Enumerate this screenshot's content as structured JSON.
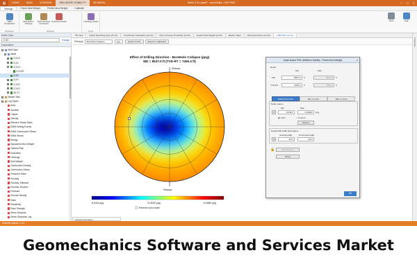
{
  "window": {
    "title": "Wells 2-XX.psset* - sceneData - LMP PMV",
    "menu": [
      "HOME",
      "DATA",
      "1D MODEL",
      "WELLBORE STABILITY",
      "3D MODEL"
    ],
    "active_menu": 3
  },
  "ribbon": {
    "tabs": [
      "Settings",
      "Check Mud Weight",
      "Predict Mud Weight",
      "Calibrate"
    ],
    "buttons": [
      "WBS Preparation",
      "Well Datum Settings",
      "Rock Settings Constants",
      "Advanced Mode",
      "Lithology Model",
      "Tools",
      "Help"
    ],
    "groups": [
      "Workflow",
      "Settings",
      "Tools"
    ]
  },
  "left_panel": {
    "header": "Active Case",
    "well_selector": "Z-XX",
    "change_link": "Change",
    "subheader": "Explorations",
    "tree": [
      {
        "label": "Well Data",
        "indent": 0,
        "box": "-",
        "color": "#6b8fc7"
      },
      {
        "label": "Wells",
        "indent": 1,
        "box": "-",
        "color": "#6b8fc7"
      },
      {
        "label": "Z-XX2",
        "indent": 2,
        "box": "+",
        "color": "#3c8d3c"
      },
      {
        "label": "Z-XX",
        "indent": 2,
        "box": "+",
        "color": "#3c8d3c"
      },
      {
        "label": "Z-XX3",
        "indent": 2,
        "box": "-",
        "color": "#3c8d3c"
      },
      {
        "label": "Z-XXST",
        "indent": 3,
        "box": "",
        "color": "#3c8d3c"
      },
      {
        "label": "Z-XX",
        "indent": 2,
        "box": "",
        "color": "#3c8d3c",
        "selected": true
      },
      {
        "label": "Z-XX",
        "indent": 2,
        "box": "+",
        "color": "#3c8d3c"
      },
      {
        "label": "Z-XX1",
        "indent": 2,
        "box": "+",
        "color": "#3c8d3c"
      },
      {
        "label": "Z-XX2",
        "indent": 2,
        "box": "+",
        "color": "#3c8d3c"
      },
      {
        "label": "ZK-27",
        "indent": 2,
        "box": "+",
        "color": "#3c8d3c"
      },
      {
        "label": "Marker Sets",
        "indent": 0,
        "box": "+",
        "color": "#c79a3a"
      },
      {
        "label": "Log Types",
        "indent": 0,
        "box": "-",
        "color": "#c79a3a"
      },
      {
        "label": "Area",
        "indent": 1,
        "box": "",
        "color": "#d44"
      },
      {
        "label": "Azimuth",
        "indent": 1,
        "box": "",
        "color": "#d44"
      },
      {
        "label": "Caliper",
        "indent": 1,
        "box": "",
        "color": "#d44"
      },
      {
        "label": "Density",
        "indent": 1,
        "box": "",
        "color": "#d44"
      },
      {
        "label": "Effective Stress Ratio",
        "indent": 1,
        "box": "",
        "color": "#d44"
      },
      {
        "label": "EMW Drilling Events",
        "indent": 1,
        "box": "",
        "color": "#d44"
      },
      {
        "label": "EMW Overburden Stress",
        "indent": 1,
        "box": "",
        "color": "#d44"
      },
      {
        "label": "EMW Stress",
        "indent": 1,
        "box": "",
        "color": "#d44"
      },
      {
        "label": "Energy",
        "indent": 1,
        "box": "",
        "color": "#d44"
      },
      {
        "label": "Equivalent Mud Weight",
        "indent": 1,
        "box": "",
        "color": "#d44"
      },
      {
        "label": "Gamma Ray",
        "indent": 1,
        "box": "",
        "color": "#d44"
      },
      {
        "label": "Inclination",
        "indent": 1,
        "box": "",
        "color": "#d44"
      },
      {
        "label": "Lithology",
        "indent": 1,
        "box": "",
        "color": "#d44"
      },
      {
        "label": "Mud Weight",
        "indent": 1,
        "box": "",
        "color": "#d44"
      },
      {
        "label": "Overburden Density",
        "indent": 1,
        "box": "",
        "color": "#d44"
      },
      {
        "label": "Overburden Stress",
        "indent": 1,
        "box": "",
        "color": "#d44"
      },
      {
        "label": "Poisson's Ratio",
        "indent": 1,
        "box": "",
        "color": "#d44"
      },
      {
        "label": "Porosity",
        "indent": 1,
        "box": "",
        "color": "#d44"
      },
      {
        "label": "Porosity, Effective",
        "indent": 1,
        "box": "",
        "color": "#d44"
      },
      {
        "label": "Porosity, Neutron",
        "indent": 1,
        "box": "",
        "color": "#d44"
      },
      {
        "label": "Pressure",
        "indent": 1,
        "box": "",
        "color": "#d44"
      },
      {
        "label": "Pseudo Density",
        "indent": 1,
        "box": "",
        "color": "#d44"
      },
      {
        "label": "Ratio",
        "indent": 1,
        "box": "",
        "color": "#d44"
      },
      {
        "label": "Resistivity",
        "indent": 1,
        "box": "",
        "color": "#d44"
      },
      {
        "label": "Rock Strength",
        "indent": 1,
        "box": "",
        "color": "#d44"
      },
      {
        "label": "Shear Modulus",
        "indent": 1,
        "box": "",
        "color": "#d44"
      },
      {
        "label": "Shear Slowness, log",
        "indent": 1,
        "box": "",
        "color": "#d44"
      }
    ]
  },
  "doc_tabs": {
    "items": [
      "3D View",
      "Depth Stretching View (Z-XX)",
      "Overburden Calculation (Z-XX)",
      "Pore Pressure Prediction (Z-XX)",
      "Predict Mud Weight (Z-XX)",
      "Marker Table",
      "Horizontal Stress (Z-XX)",
      "LMP PMV (Z-XX)"
    ],
    "active": 7
  },
  "toolbar": {
    "plot_type_label": "Plot type:",
    "plot_type_value": "BoreHole Collapse",
    "small_select": "ppg",
    "export_file": "Export to File",
    "export_clipboard": "Export to Clipboard"
  },
  "chart": {
    "title_line1": "Effect of Drilling Direction - BoreHole Collapse (ppg)",
    "title_line2": "MD = 8537.0 ft (TVD-RT = 7450.4 ft)",
    "label_north": "Shmax",
    "label_south": "Shmax",
    "colorbar_min": "8.0414 ppg",
    "colorbar_mid": "11.5032 ppg",
    "colorbar_max": "14.9650 ppg",
    "reverse_label": "Reverse color scale"
  },
  "dialog": {
    "title": "Depth Based PMV (WellBore Stability - Predict Mud Weight)",
    "depth_label": "Depth",
    "min_label": "Min",
    "max_label": "Max",
    "md_label": "MD",
    "md_min": "8537.0",
    "md_max": "8537.0",
    "tvd_label": "TVD-RT",
    "tvd_min": "7450.4",
    "tvd_max": "7450.4",
    "unit_ft": "ft",
    "tabs": [
      "Drilling Direction",
      "BD vs UCS",
      "MW vs UCS"
    ],
    "active_tab": 0,
    "scale_label": "Scale values",
    "scale_min_label": "Min",
    "scale_max_label": "Max",
    "scale_min": "8.0414",
    "scale_max": "14.9650",
    "unit_ppg": "ppg",
    "color_label": "Color",
    "contour_label": "Contour",
    "options_label": "Options",
    "default_label": "Default BD width field values",
    "vert_label": "Vertical width",
    "horiz_label": "Horizontal width",
    "vert_value": "30.0",
    "horiz_value": "30.0",
    "recalc": "ReCalculate",
    "show": "Show",
    "ok": "OK"
  },
  "right_strip": "Properties",
  "output_tab": "Output Information",
  "status_text": "Selected objects: Z-XX",
  "caption": "Geomechanics Software and Services Market",
  "chart_data": {
    "type": "heatmap",
    "title": "Effect of Drilling Direction - BoreHole Collapse (ppg)",
    "subtitle": "MD = 8537.0 ft (TVD-RT = 7450.4 ft)",
    "value_min": 8.0414,
    "value_max": 14.965,
    "value_mid": 11.5032,
    "unit": "ppg",
    "colorscale": [
      "#00008f",
      "#0000ff",
      "#00ffff",
      "#ffff00",
      "#ff0000",
      "#800000"
    ]
  },
  "colors": {
    "title_bar": "#d66a20",
    "status_bar": "#e47d24",
    "accent": "#3d7cc9"
  }
}
